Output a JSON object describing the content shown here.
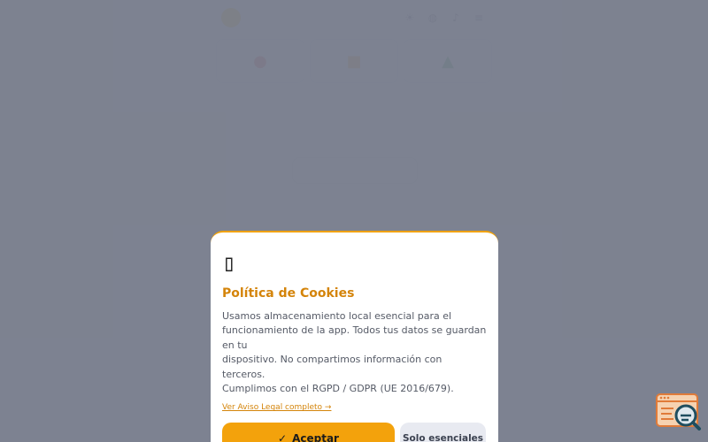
{
  "app": {
    "header": {
      "brand": "",
      "icons": [
        "sun-icon",
        "globe-icon",
        "bell-icon",
        "menu-icon"
      ]
    },
    "cards": [
      {
        "icon": "pin-icon",
        "color": "#e53935"
      },
      {
        "icon": "bag-icon",
        "color": "#f39c12"
      },
      {
        "icon": "leaf-icon",
        "color": "#2ea043"
      }
    ]
  },
  "cookie_modal": {
    "icon": "▯",
    "title": "Política de Cookies",
    "text_lines": [
      "Usamos almacenamiento local esencial para el",
      "funcionamiento de la app. Todos tus datos se guardan en tu",
      "dispositivo. No compartimos información con terceros.",
      "Cumplimos con el RGPD / GDPR (UE 2016/679)."
    ],
    "link": "Ver Aviso Legal completo →",
    "accept_check": "✓",
    "accept_label": "Aceptar",
    "essential_label": "Solo esenciales"
  },
  "colors": {
    "accent": "#f3a20c",
    "title": "#d4840a",
    "overlay": "#787d8c"
  },
  "fab": {
    "icon": "search-window-icon"
  }
}
